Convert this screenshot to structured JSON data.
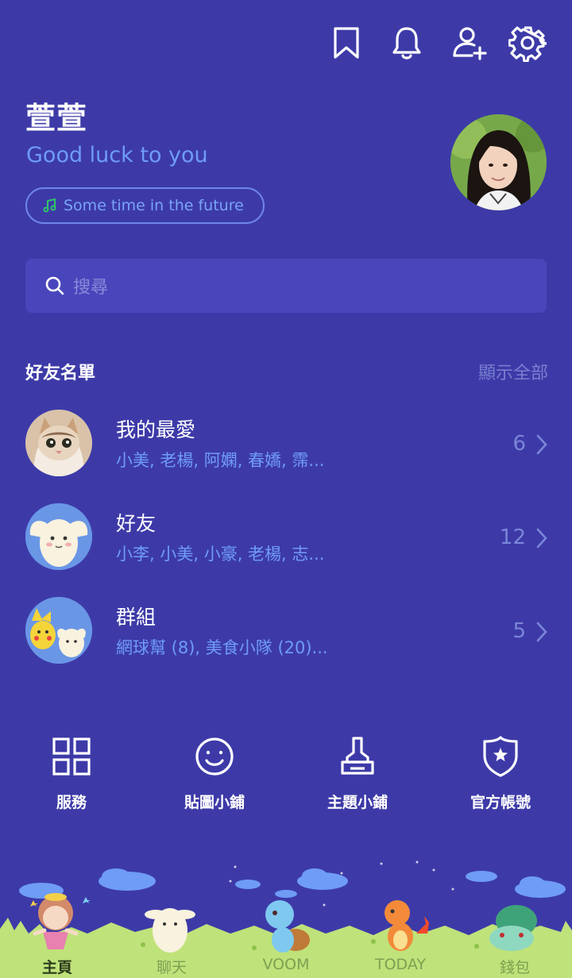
{
  "header": {
    "icons": [
      "bookmark-icon",
      "bell-icon",
      "add-friend-icon",
      "gear-icon"
    ]
  },
  "profile": {
    "name": "萱萱",
    "status": "Good luck to you",
    "music": "Some time in the future"
  },
  "search": {
    "placeholder": "搜尋"
  },
  "friends": {
    "header": "好友名單",
    "show_all": "顯示全部",
    "rows": [
      {
        "title": "我的最愛",
        "subtitle": "小美, 老楊, 阿嫻, 春嬌, 霈...",
        "count": "6"
      },
      {
        "title": "好友",
        "subtitle": "小李, 小美, 小豪, 老楊, 志...",
        "count": "12"
      },
      {
        "title": "群組",
        "subtitle": "網球幫 (8), 美食小隊 (20)...",
        "count": "5"
      }
    ]
  },
  "services": [
    {
      "label": "服務",
      "icon": "grid-icon"
    },
    {
      "label": "貼圖小鋪",
      "icon": "smile-icon"
    },
    {
      "label": "主題小鋪",
      "icon": "brush-icon"
    },
    {
      "label": "官方帳號",
      "icon": "shield-star-icon"
    }
  ],
  "tabs": [
    {
      "label": "主頁",
      "active": true
    },
    {
      "label": "聊天",
      "active": false
    },
    {
      "label": "VOOM",
      "active": false
    },
    {
      "label": "TODAY",
      "active": false
    },
    {
      "label": "錢包",
      "active": false
    }
  ],
  "colors": {
    "background": "#3d3aa8",
    "accent_text": "#6f9cf5",
    "grass": "#bfe27a"
  }
}
